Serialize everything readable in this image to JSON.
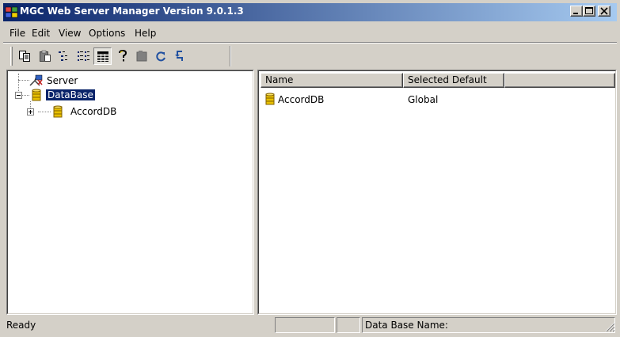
{
  "window": {
    "title": "MGC Web Server Manager Version 9.0.1.3"
  },
  "menu": {
    "items": [
      {
        "label": "File"
      },
      {
        "label": "Edit"
      },
      {
        "label": "View"
      },
      {
        "label": "Options"
      },
      {
        "label": "Help"
      }
    ]
  },
  "toolbar": {
    "buttons": [
      {
        "icon": "copy-icon"
      },
      {
        "icon": "paste-icon"
      },
      {
        "icon": "list-view-icon"
      },
      {
        "icon": "detail-view-icon"
      },
      {
        "icon": "grid-view-icon",
        "pressed": true
      },
      {
        "icon": "help-icon"
      },
      {
        "icon": "folder-icon"
      },
      {
        "icon": "refresh-icon"
      },
      {
        "icon": "reload-icon"
      }
    ]
  },
  "tree": {
    "nodes": [
      {
        "label": "Server",
        "icon": "server-icon"
      },
      {
        "label": "DataBase",
        "icon": "database-icon",
        "selected": true
      },
      {
        "label": "AccordDB",
        "icon": "database-icon"
      }
    ]
  },
  "list": {
    "columns": [
      {
        "label": "Name"
      },
      {
        "label": "Selected Default"
      }
    ],
    "rows": [
      {
        "name": "AccordDB",
        "selected_default": "Global",
        "icon": "database-icon"
      }
    ]
  },
  "status": {
    "text": "Ready",
    "cell2": "",
    "cell3": "",
    "db_name_label": "Data Base Name:"
  },
  "colors": {
    "title_start": "#0a246a",
    "title_end": "#a6caf0",
    "face": "#d4d0c8",
    "selection": "#0a246a",
    "db_icon": "#e8c000"
  }
}
